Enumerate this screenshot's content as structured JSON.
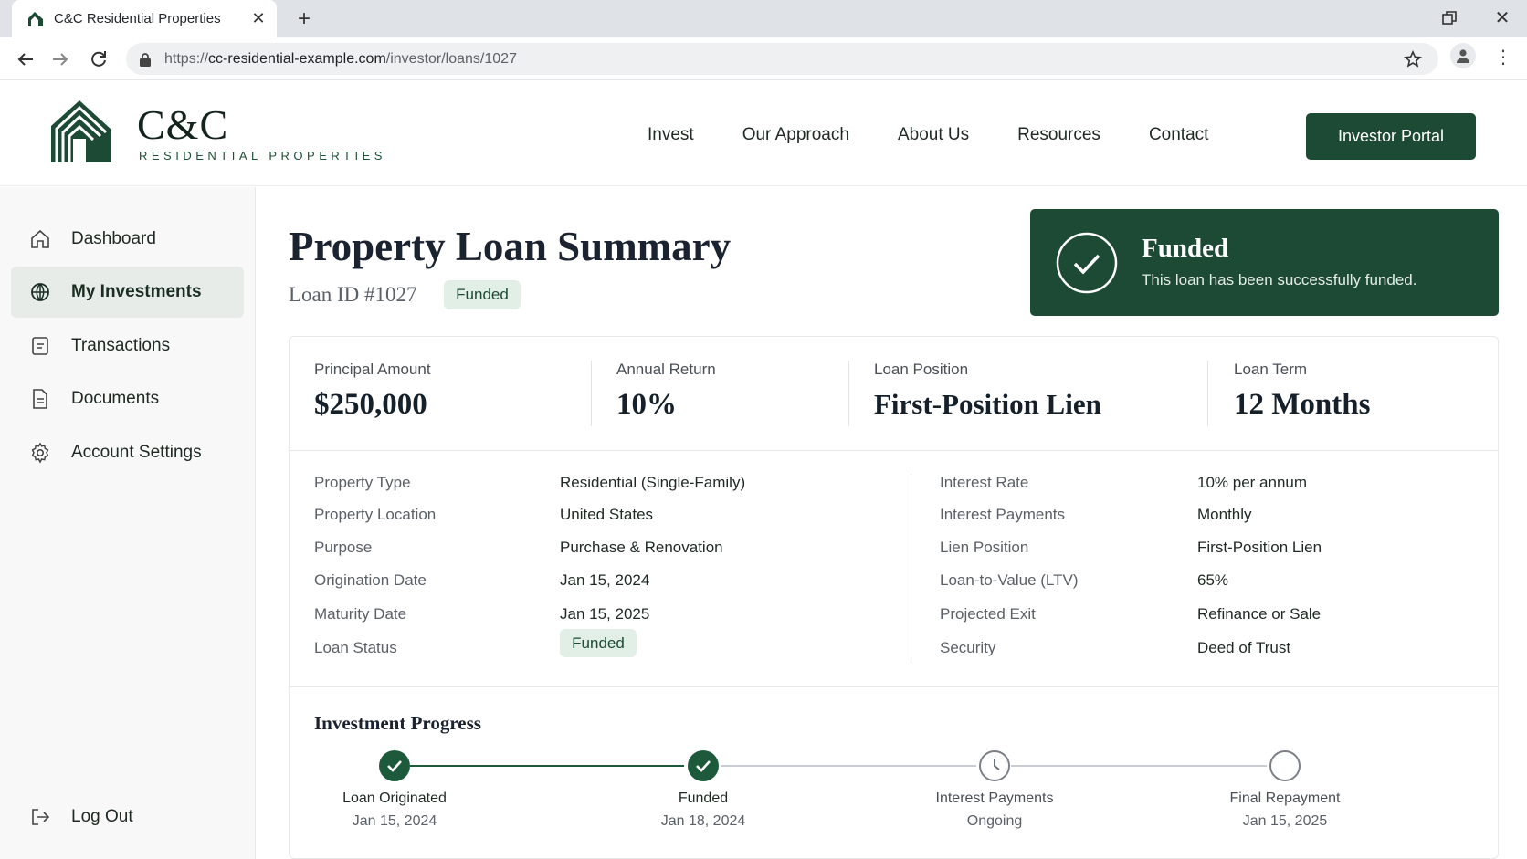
{
  "browser": {
    "tab_title": "C&C Residential Properties",
    "url_scheme": "https://",
    "url_host": "cc-residential-example.com",
    "url_path": "/investor/loans/1027"
  },
  "header": {
    "logo_name": "C&C",
    "logo_sub": "RESIDENTIAL PROPERTIES",
    "nav": [
      "Invest",
      "Our Approach",
      "About Us",
      "Resources",
      "Contact"
    ],
    "portal_button": "Investor Portal"
  },
  "sidebar": {
    "items": [
      {
        "label": "Dashboard",
        "icon": "home-icon"
      },
      {
        "label": "My Investments",
        "icon": "globe-icon",
        "active": true
      },
      {
        "label": "Transactions",
        "icon": "receipt-icon"
      },
      {
        "label": "Documents",
        "icon": "document-icon"
      },
      {
        "label": "Account Settings",
        "icon": "gear-icon"
      }
    ],
    "logout": "Log Out"
  },
  "main": {
    "title": "Property Loan Summary",
    "loan_id": "Loan ID #1027",
    "loan_badge": "Funded",
    "banner": {
      "title": "Funded",
      "message": "This loan has been successfully funded."
    },
    "metrics": [
      {
        "label": "Principal Amount",
        "value": "$250,000"
      },
      {
        "label": "Annual Return",
        "value": "10%"
      },
      {
        "label": "Loan Position",
        "value": "First-Position Lien"
      },
      {
        "label": "Loan Term",
        "value": "12 Months"
      }
    ],
    "details_left": [
      {
        "label": "Property Type",
        "value": "Residential (Single-Family)"
      },
      {
        "label": "Property Location",
        "value": "United States"
      },
      {
        "label": "Purpose",
        "value": "Purchase & Renovation"
      },
      {
        "label": "Origination Date",
        "value": "Jan 15, 2024"
      },
      {
        "label": "Maturity Date",
        "value": "Jan 15, 2025"
      },
      {
        "label": "Loan Status",
        "value": "Funded"
      }
    ],
    "details_right": [
      {
        "label": "Interest Rate",
        "value": "10% per annum"
      },
      {
        "label": "Interest Payments",
        "value": "Monthly"
      },
      {
        "label": "Lien Position",
        "value": "First-Position Lien"
      },
      {
        "label": "Loan-to-Value (LTV)",
        "value": "65%"
      },
      {
        "label": "Projected Exit",
        "value": "Refinance or Sale"
      },
      {
        "label": "Security",
        "value": "Deed of Trust"
      }
    ],
    "progress": {
      "title": "Investment Progress",
      "steps": [
        {
          "label": "Loan Originated",
          "date": "Jan 15, 2024",
          "state": "done"
        },
        {
          "label": "Funded",
          "date": "Jan 18, 2024",
          "state": "done"
        },
        {
          "label": "Interest Payments",
          "date": "Ongoing",
          "state": "in-progress"
        },
        {
          "label": "Final Repayment",
          "date": "Jan 15, 2025",
          "state": "pending"
        }
      ]
    }
  },
  "colors": {
    "brand_green": "#1d4a34",
    "badge_bg": "#e2efe6",
    "sidebar_bg": "#f7f8f7"
  }
}
